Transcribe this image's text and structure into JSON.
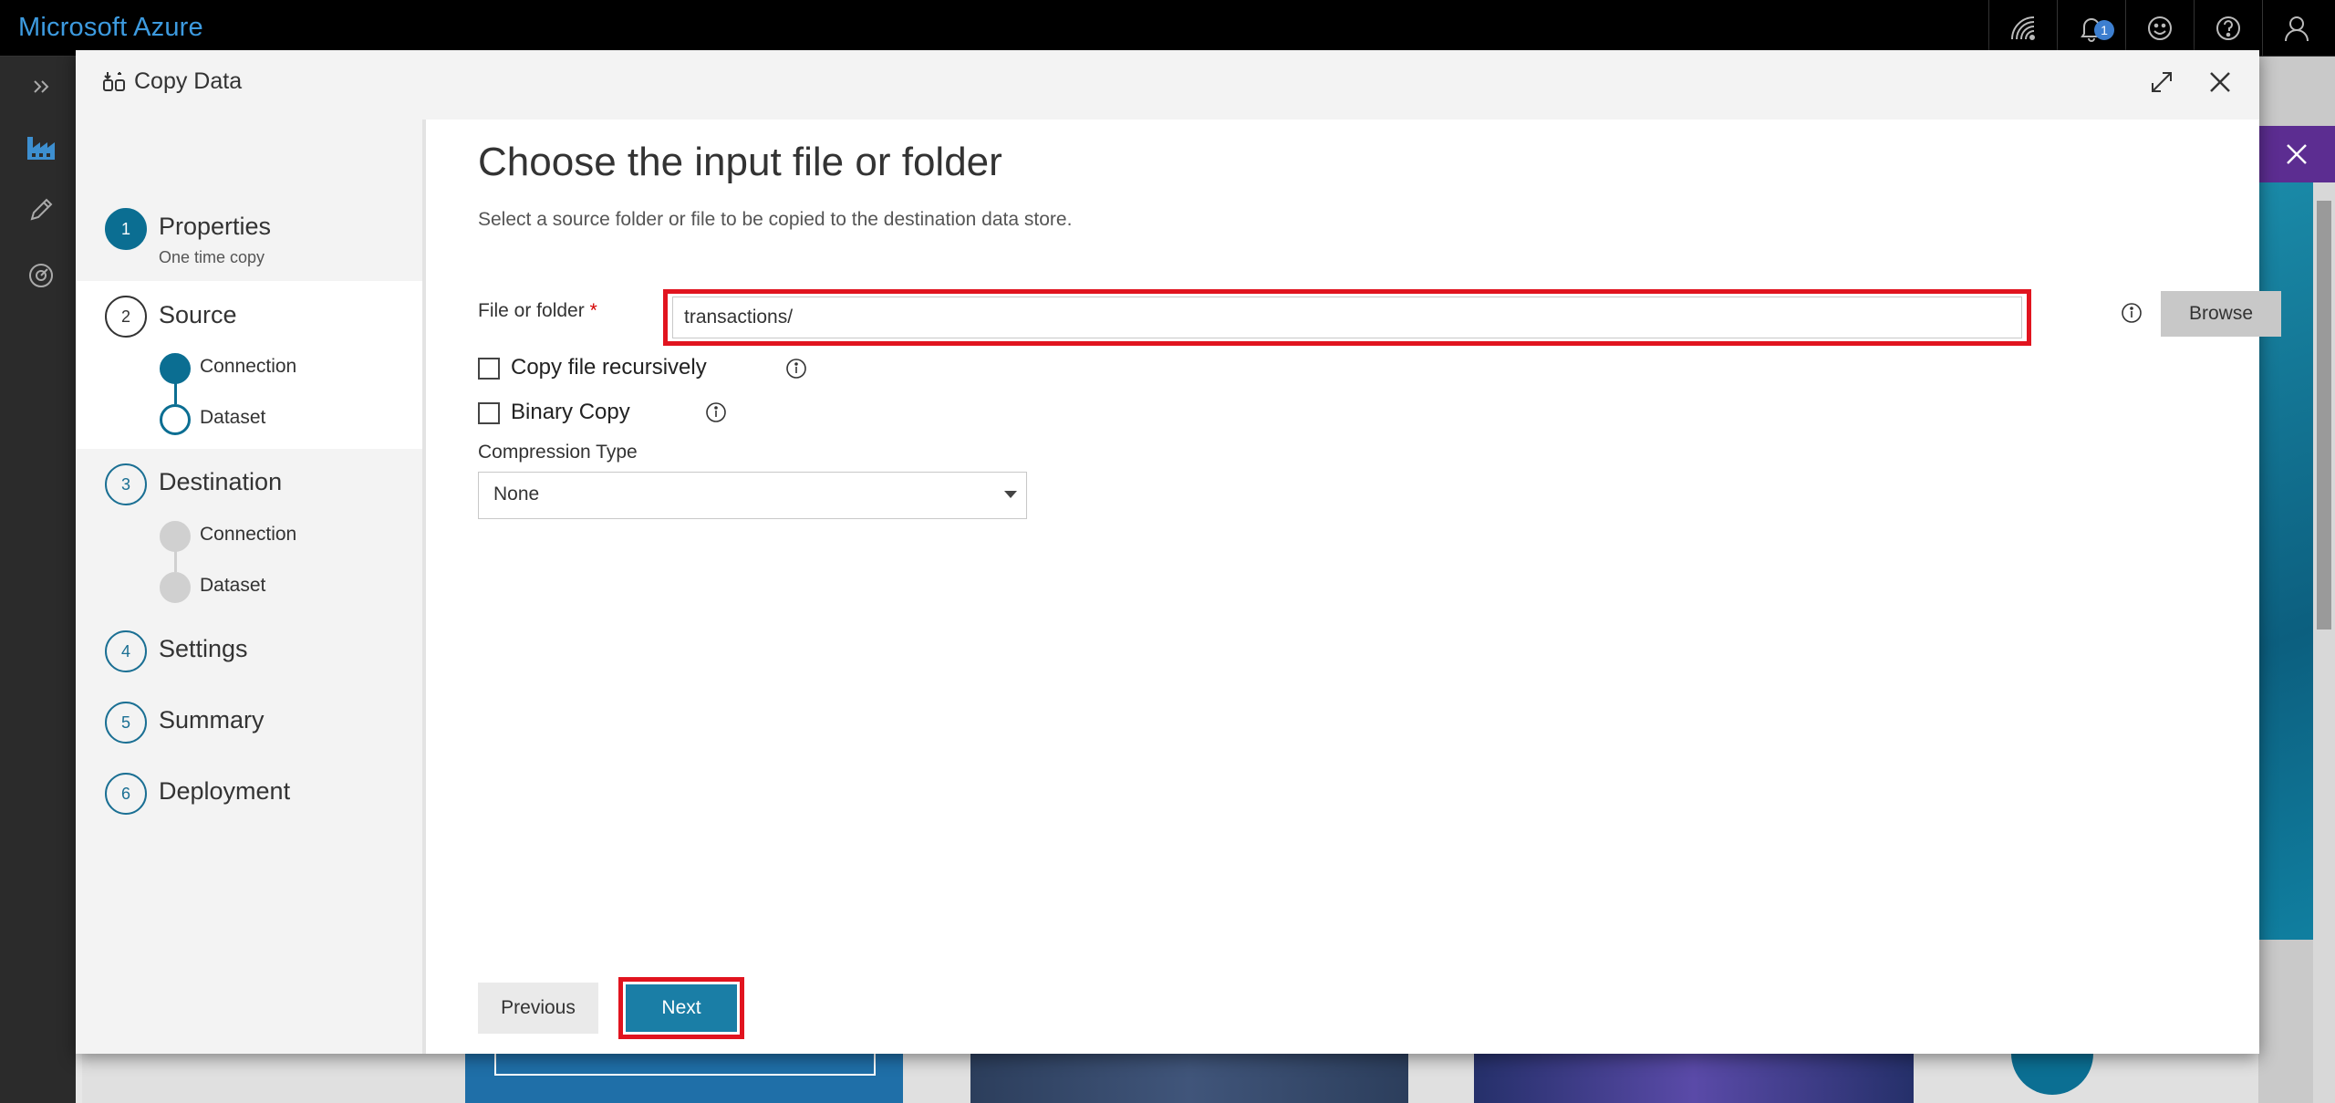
{
  "app": {
    "brand": "Microsoft Azure"
  },
  "topbar": {
    "icons": [
      "wifi-icon",
      "notification-bell-icon",
      "feedback-smiley-icon",
      "help-icon",
      "user-icon"
    ],
    "notification_count": "1"
  },
  "rail": {
    "icons": [
      "expand-chevrons-icon",
      "factory-icon",
      "pencil-icon",
      "monitor-gauge-icon"
    ]
  },
  "dialog": {
    "title": "Copy Data",
    "steps": [
      {
        "number": "1",
        "label": "Properties",
        "sub": "One time copy"
      },
      {
        "number": "2",
        "label": "Source",
        "substeps": [
          "Connection",
          "Dataset"
        ]
      },
      {
        "number": "3",
        "label": "Destination",
        "substeps": [
          "Connection",
          "Dataset"
        ]
      },
      {
        "number": "4",
        "label": "Settings"
      },
      {
        "number": "5",
        "label": "Summary"
      },
      {
        "number": "6",
        "label": "Deployment"
      }
    ],
    "content": {
      "title": "Choose the input file or folder",
      "description": "Select a source folder or file to be copied to the destination data store.",
      "file_label": "File or folder",
      "required_marker": "*",
      "file_value": "transactions/",
      "browse_label": "Browse",
      "recursive_label": "Copy file recursively",
      "binary_label": "Binary Copy",
      "compression_label": "Compression Type",
      "compression_value": "None",
      "previous_label": "Previous",
      "next_label": "Next"
    }
  },
  "colors": {
    "accent": "#0b6e92",
    "brand": "#3d9be0",
    "highlight": "#e1141f",
    "next": "#1a7ea6"
  }
}
